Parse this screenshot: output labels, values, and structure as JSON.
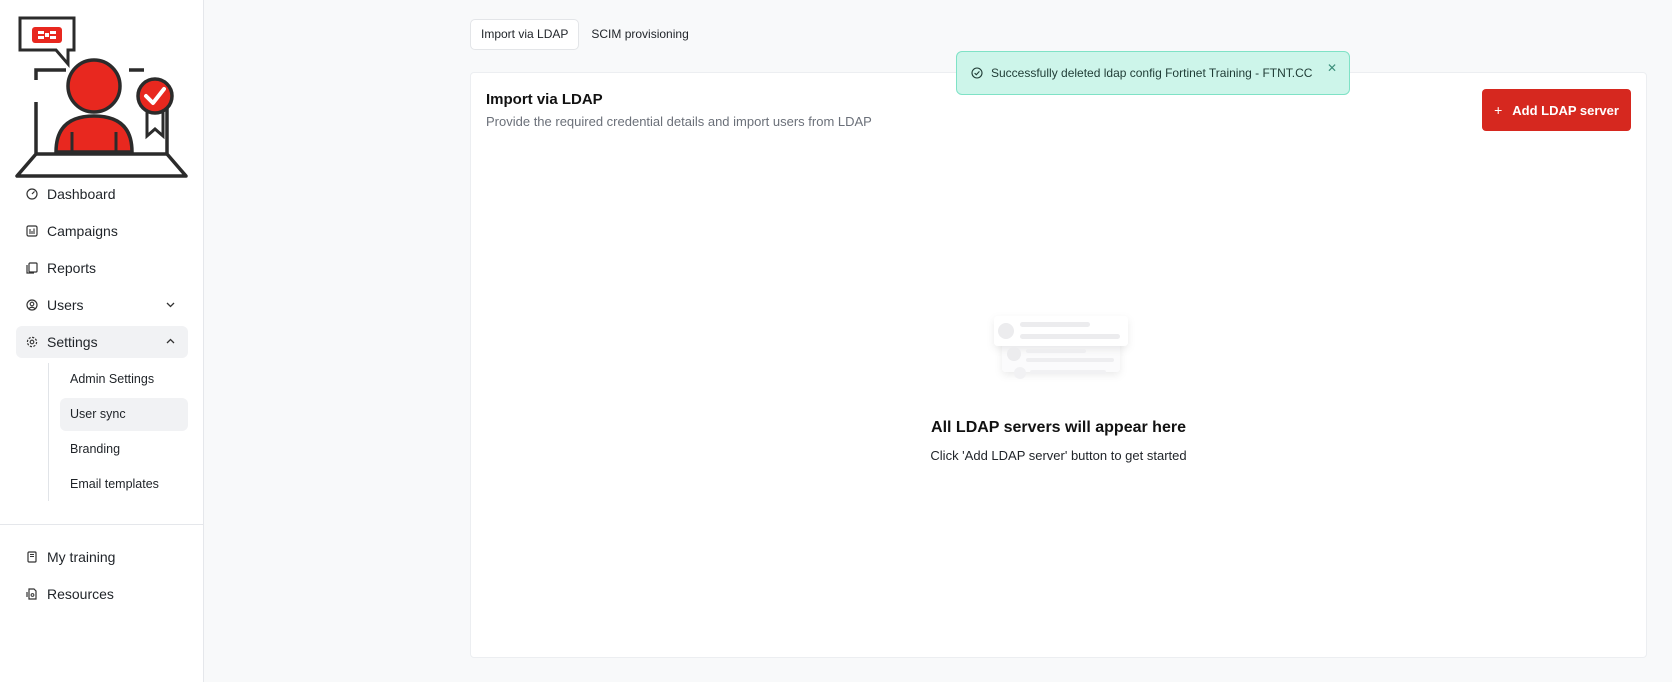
{
  "sidebar": {
    "logo": "fortinet-training-logo",
    "items": [
      {
        "label": "Dashboard",
        "icon": "dashboard-icon"
      },
      {
        "label": "Campaigns",
        "icon": "campaigns-icon"
      },
      {
        "label": "Reports",
        "icon": "reports-icon"
      },
      {
        "label": "Users",
        "icon": "users-icon",
        "expandable": true
      },
      {
        "label": "Settings",
        "icon": "settings-icon",
        "expanded": true
      }
    ],
    "settings_subitems": [
      "Admin Settings",
      "User sync",
      "Branding",
      "Email templates"
    ],
    "active_subitem": "User sync",
    "bottom_items": [
      {
        "label": "My training",
        "icon": "book-icon"
      },
      {
        "label": "Resources",
        "icon": "resources-icon"
      }
    ]
  },
  "tabs": [
    {
      "label": "Import via LDAP",
      "active": true
    },
    {
      "label": "SCIM provisioning",
      "active": false
    }
  ],
  "card": {
    "title": "Import via LDAP",
    "subtitle": "Provide the required credential details and import users from LDAP",
    "add_button": "Add LDAP server",
    "add_button_icon": "plus-icon",
    "empty_title": "All LDAP servers will appear here",
    "empty_subtitle": "Click 'Add LDAP server' button to get started"
  },
  "toast": {
    "message": "Successfully deleted ldap config Fortinet Training - FTNT.CC",
    "icon": "check-circle-icon",
    "close_icon": "close-icon"
  },
  "colors": {
    "accent": "#d6281f",
    "toast_bg": "#cdf5ea",
    "toast_border": "#7fe2c6",
    "page_bg": "#f8f9fa"
  }
}
